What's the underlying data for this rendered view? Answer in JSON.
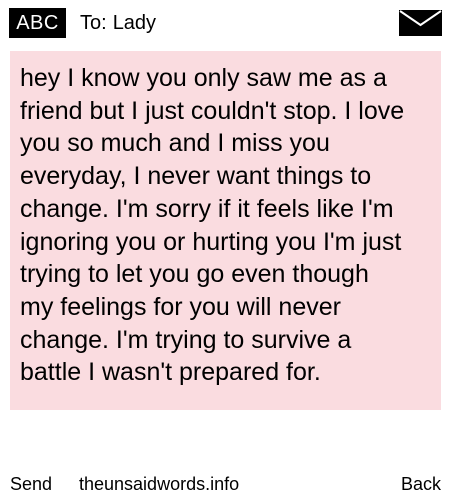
{
  "header": {
    "badge": "ABC",
    "to_label": "To:",
    "recipient": "Lady",
    "icon": "envelope-icon"
  },
  "message": {
    "text": "hey I know you only saw me as a\nfriend but I just couldn't stop. I love\nyou so much and I miss you\neveryday, I never want things to\nchange. I'm sorry if it feels like I'm\nignoring you or hurting you I'm just\ntrying to let you go even though\nmy  feelings for you will never\nchange. I'm trying to survive a\nbattle I wasn't prepared for."
  },
  "footer": {
    "send_label": "Send",
    "site": "theunsaidwords.info",
    "back_label": "Back"
  },
  "colors": {
    "message_background": "#fadce0",
    "badge_background": "#000000",
    "badge_text": "#ffffff"
  }
}
